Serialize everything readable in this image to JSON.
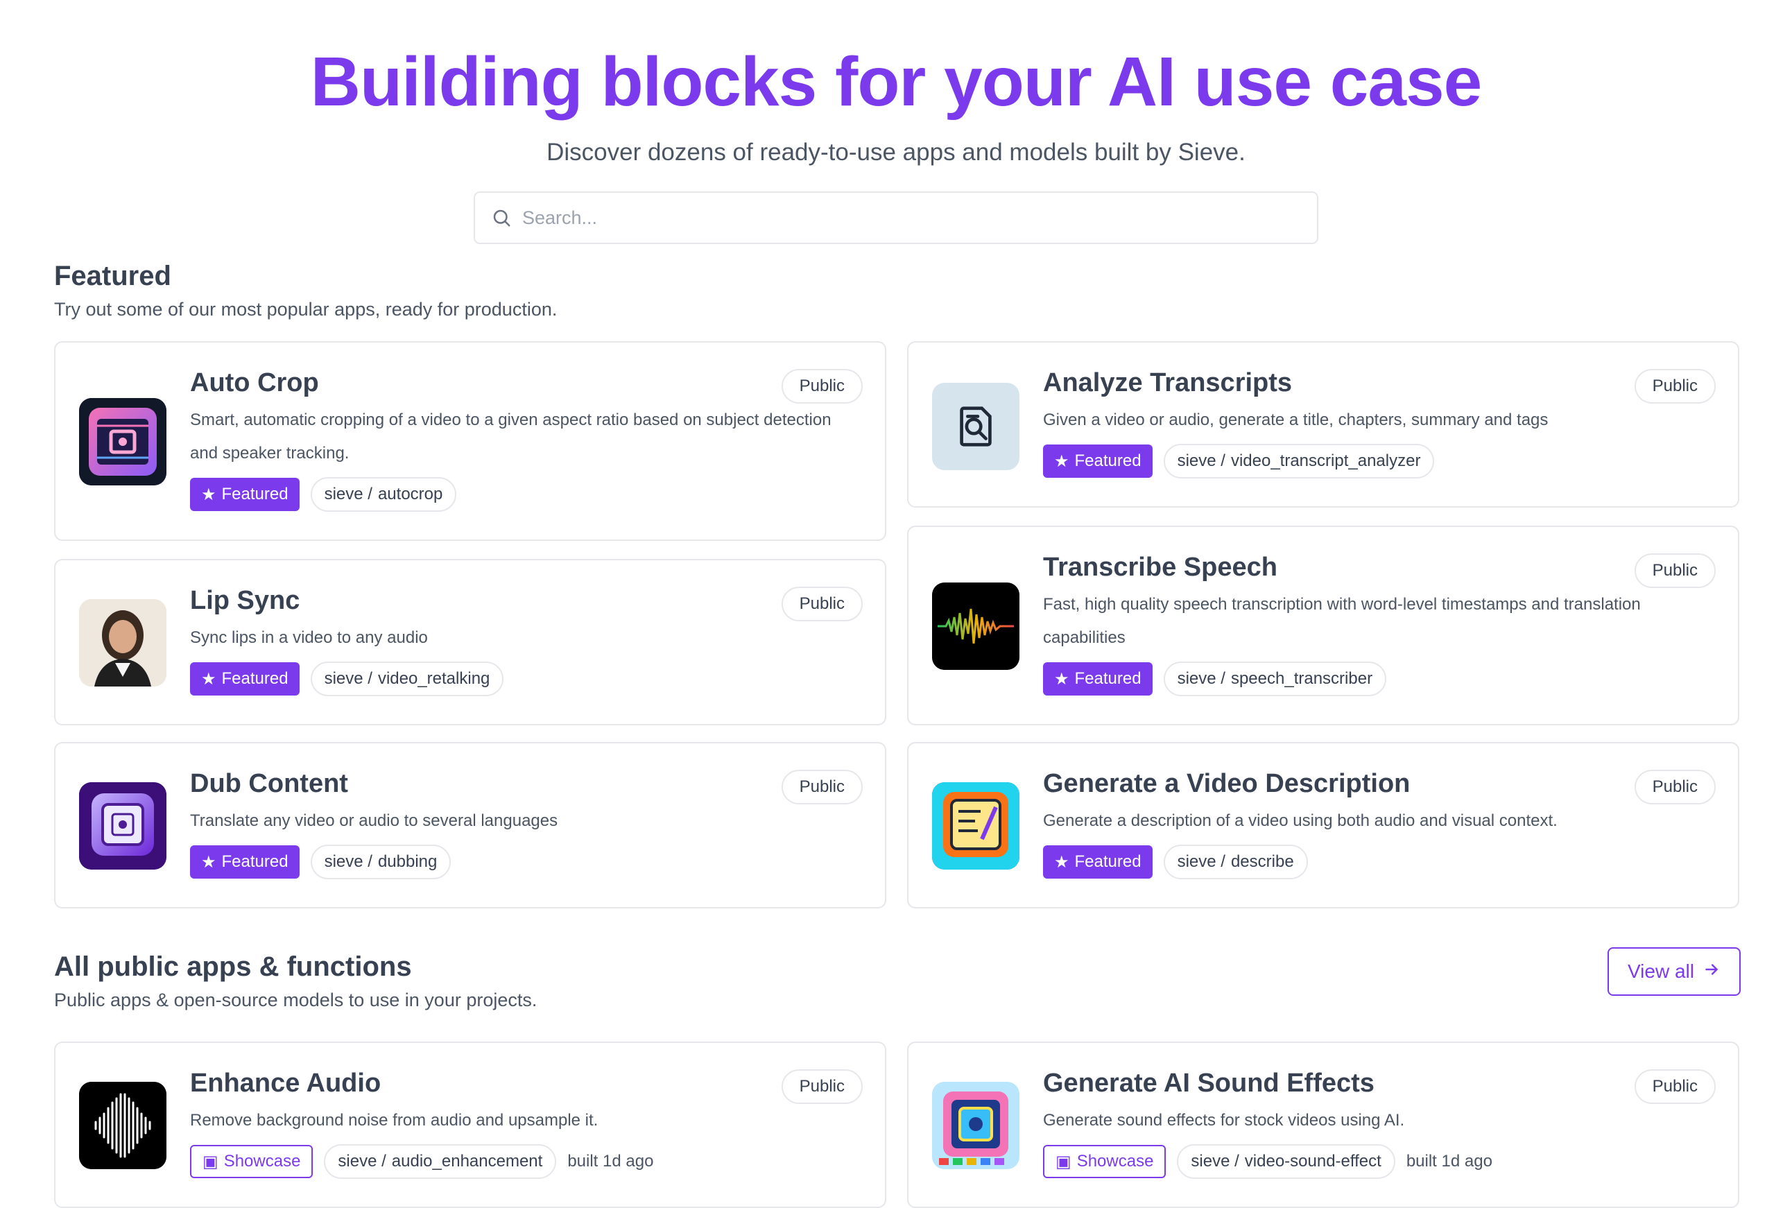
{
  "hero": {
    "title": "Building blocks for your AI use case",
    "subtitle": "Discover dozens of ready-to-use apps and models built by Sieve."
  },
  "search": {
    "placeholder": "Search...",
    "icon": "search-icon"
  },
  "featured": {
    "title": "Featured",
    "description": "Try out some of our most popular apps, ready for production.",
    "cards": [
      {
        "title": "Auto Crop",
        "description": "Smart, automatic cropping of a video to a given aspect ratio based on subject detection and speaker tracking.",
        "visibility": "Public",
        "tag": "Featured",
        "owner": "sieve /",
        "slug": "autocrop"
      },
      {
        "title": "Analyze Transcripts",
        "description": "Given a video or audio, generate a title, chapters, summary and tags",
        "visibility": "Public",
        "tag": "Featured",
        "owner": "sieve /",
        "slug": "video_transcript_analyzer"
      },
      {
        "title": "Lip Sync",
        "description": "Sync lips in a video to any audio",
        "visibility": "Public",
        "tag": "Featured",
        "owner": "sieve /",
        "slug": "video_retalking"
      },
      {
        "title": "Transcribe Speech",
        "description": "Fast, high quality speech transcription with word-level timestamps and translation capabilities",
        "visibility": "Public",
        "tag": "Featured",
        "owner": "sieve /",
        "slug": "speech_transcriber"
      },
      {
        "title": "Dub Content",
        "description": "Translate any video or audio to several languages",
        "visibility": "Public",
        "tag": "Featured",
        "owner": "sieve /",
        "slug": "dubbing"
      },
      {
        "title": "Generate a Video Description",
        "description": "Generate a description of a video using both audio and visual context.",
        "visibility": "Public",
        "tag": "Featured",
        "owner": "sieve /",
        "slug": "describe"
      }
    ]
  },
  "public_apps": {
    "title": "All public apps & functions",
    "description": "Public apps & open-source models to use in your projects.",
    "view_all": "View all",
    "cards": [
      {
        "title": "Enhance Audio",
        "description": "Remove background noise from audio and upsample it.",
        "visibility": "Public",
        "tag": "Showcase",
        "owner": "sieve /",
        "slug": "audio_enhancement",
        "built": "built 1d ago"
      },
      {
        "title": "Generate AI Sound Effects",
        "description": "Generate sound effects for stock videos using AI.",
        "visibility": "Public",
        "tag": "Showcase",
        "owner": "sieve /",
        "slug": "video-sound-effect",
        "built": "built 1d ago"
      }
    ]
  },
  "colors": {
    "accent": "#7c3aed",
    "border": "#e5e7eb",
    "text": "#374151",
    "muted": "#4b5563"
  }
}
